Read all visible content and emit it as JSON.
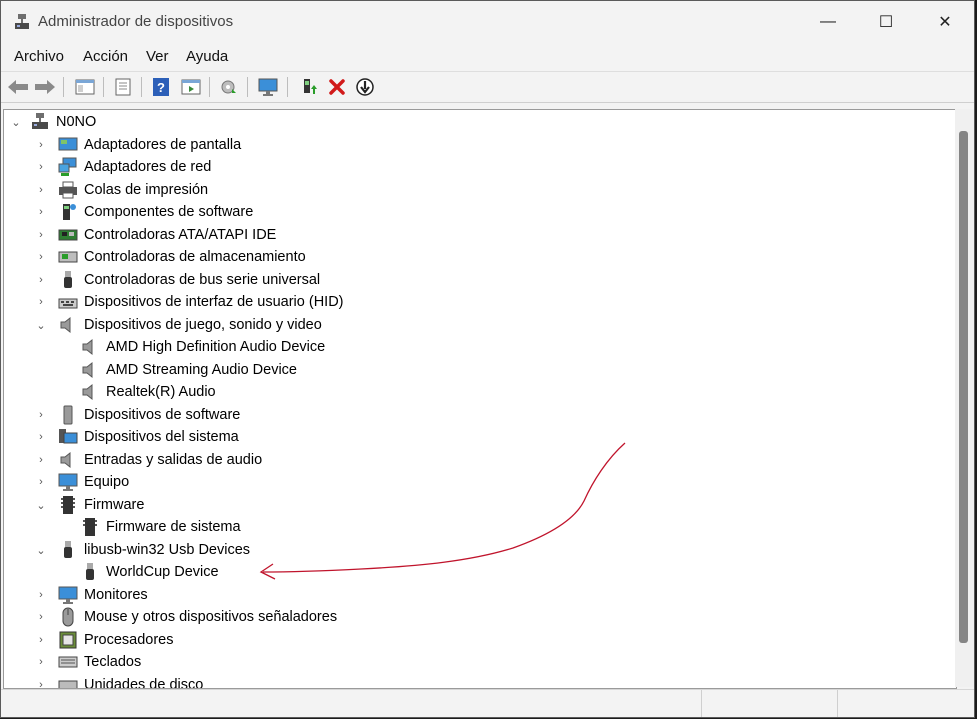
{
  "window": {
    "title": "Administrador de dispositivos",
    "controls": {
      "minimize": "—",
      "maximize": "☐",
      "close": "✕"
    }
  },
  "menu": [
    "Archivo",
    "Acción",
    "Ver",
    "Ayuda"
  ],
  "toolbar_icons": [
    "back-arrow-icon",
    "forward-arrow-icon",
    "show-hide-console-tree-icon",
    "properties-icon",
    "help-icon",
    "action-pane-icon",
    "update-driver-icon",
    "scan-hardware-icon",
    "enable-device-icon",
    "uninstall-device-icon",
    "disable-device-icon"
  ],
  "tree": {
    "root": "N0NO",
    "categories": [
      "Adaptadores de pantalla",
      "Adaptadores de red",
      "Colas de impresión",
      "Componentes de software",
      "Controladoras ATA/ATAPI IDE",
      "Controladoras de almacenamiento",
      "Controladoras de bus serie universal",
      "Dispositivos de interfaz de usuario (HID)",
      "Dispositivos de juego, sonido y video",
      "Dispositivos de software",
      "Dispositivos del sistema",
      "Entradas y salidas de audio",
      "Equipo",
      "Firmware",
      "libusb-win32 Usb Devices",
      "Monitores",
      "Mouse y otros dispositivos señaladores",
      "Procesadores",
      "Teclados",
      "Unidades de disco"
    ],
    "sound_children": [
      "AMD High Definition Audio Device",
      "AMD Streaming Audio Device",
      "Realtek(R) Audio"
    ],
    "firmware_children": [
      "Firmware de sistema"
    ],
    "libusb_children": [
      "WorldCup Device"
    ]
  },
  "colors": {
    "annotation": "#c0142c",
    "accent": "#0078d4",
    "remove": "#d11a1a",
    "enable": "#2a9d2a"
  }
}
